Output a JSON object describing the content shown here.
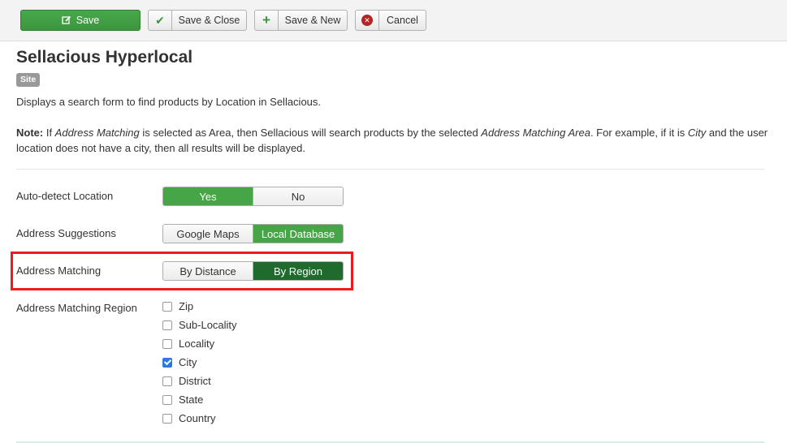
{
  "toolbar": {
    "save_label": "Save",
    "save_close_label": "Save & Close",
    "save_new_label": "Save & New",
    "cancel_label": "Cancel"
  },
  "page": {
    "title": "Sellacious Hyperlocal",
    "badge": "Site",
    "description": "Displays a search form to find products by Location in Sellacious.",
    "note": {
      "prefix": "Note:",
      "t1": " If ",
      "i1": "Address Matching",
      "t2": " is selected as Area, then Sellacious will search products by the selected ",
      "i2": "Address Matching Area",
      "t3": ". For example, if it is ",
      "i3": "City",
      "t4": " and the user location does not have a city, then all results will be displayed."
    }
  },
  "fields": {
    "auto_detect": {
      "label": "Auto-detect Location",
      "options": [
        "Yes",
        "No"
      ],
      "selected": "Yes"
    },
    "address_suggestions": {
      "label": "Address Suggestions",
      "options": [
        "Google Maps",
        "Local Database"
      ],
      "selected": "Local Database"
    },
    "address_matching": {
      "label": "Address Matching",
      "options": [
        "By Distance",
        "By Region"
      ],
      "selected": "By Region"
    },
    "matching_region": {
      "label": "Address Matching Region",
      "items": [
        {
          "label": "Zip",
          "checked": false
        },
        {
          "label": "Sub-Locality",
          "checked": false
        },
        {
          "label": "Locality",
          "checked": false
        },
        {
          "label": "City",
          "checked": true
        },
        {
          "label": "District",
          "checked": false
        },
        {
          "label": "State",
          "checked": false
        },
        {
          "label": "Country",
          "checked": false
        }
      ]
    }
  },
  "colors": {
    "accent_green": "#46a546",
    "selected_dark_green": "#1e6b2d",
    "highlight_red": "#f0191c",
    "checkbox_blue": "#2a7ae2"
  }
}
